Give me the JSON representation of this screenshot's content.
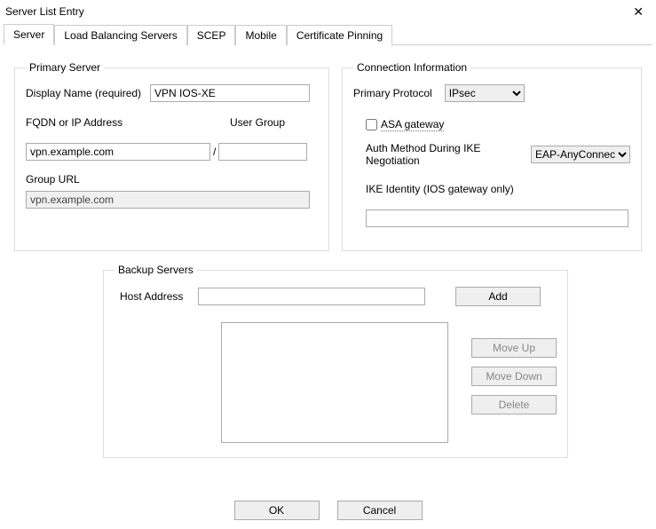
{
  "window": {
    "title": "Server List Entry"
  },
  "tabs": {
    "server": "Server",
    "lbs": "Load Balancing Servers",
    "scep": "SCEP",
    "mobile": "Mobile",
    "certpin": "Certificate Pinning"
  },
  "primaryServer": {
    "legend": "Primary Server",
    "displayNameLabel": "Display Name (required)",
    "displayNameValue": "VPN IOS-XE",
    "fqdnLabel": "FQDN or IP Address",
    "fqdnValue": "vpn.example.com",
    "userGroupLabel": "User Group",
    "userGroupValue": "",
    "groupUrlLabel": "Group URL",
    "groupUrlValue": "vpn.example.com"
  },
  "connInfo": {
    "legend": "Connection Information",
    "primaryProtocolLabel": "Primary Protocol",
    "primaryProtocolValue": "IPsec",
    "asaGatewayLabel": "ASA gateway",
    "asaGatewayChecked": false,
    "authMethodLabel": "Auth Method During IKE Negotiation",
    "authMethodValue": "EAP-AnyConnect",
    "ikeIdentityLabel": "IKE Identity (IOS gateway only)",
    "ikeIdentityValue": ""
  },
  "backup": {
    "legend": "Backup Servers",
    "hostAddressLabel": "Host Address",
    "hostAddressValue": "",
    "addLabel": "Add",
    "moveUpLabel": "Move Up",
    "moveDownLabel": "Move Down",
    "deleteLabel": "Delete"
  },
  "buttons": {
    "ok": "OK",
    "cancel": "Cancel"
  }
}
